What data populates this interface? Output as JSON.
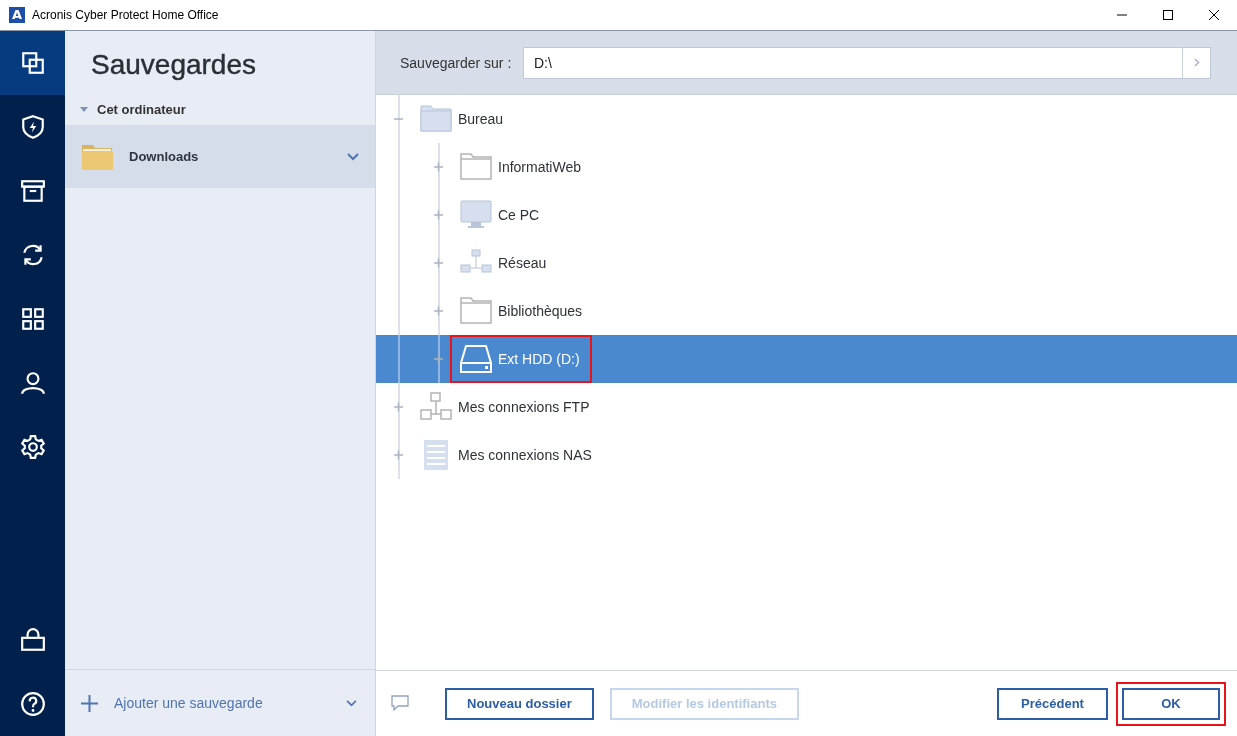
{
  "window": {
    "logo": "A",
    "title": "Acronis Cyber Protect Home Office"
  },
  "nav": {
    "top": [
      {
        "selected": true
      },
      {
        "selected": false
      },
      {
        "selected": false
      },
      {
        "selected": false
      },
      {
        "selected": false
      },
      {
        "selected": false
      },
      {
        "selected": false
      }
    ],
    "bottom": [
      {
        "selected": false
      },
      {
        "selected": false
      }
    ]
  },
  "backups_panel": {
    "title": "Sauvegardes",
    "section": {
      "label": "Cet ordinateur",
      "expanded": true
    },
    "items": [
      {
        "name": "Downloads",
        "selected": true
      }
    ],
    "add_label": "Ajouter une sauvegarde"
  },
  "destination": {
    "label": "Sauvegarder sur :",
    "path": "D:\\"
  },
  "tree": [
    {
      "label": "Bureau",
      "kind": "desktop",
      "expanded": true,
      "selected": false,
      "highlighted": false,
      "children": [
        {
          "label": "InformatiWeb",
          "kind": "folder",
          "expanded": false,
          "selected": false,
          "highlighted": false
        },
        {
          "label": "Ce PC",
          "kind": "computer",
          "expanded": false,
          "selected": false,
          "highlighted": false
        },
        {
          "label": "Réseau",
          "kind": "network",
          "expanded": false,
          "selected": false,
          "highlighted": false
        },
        {
          "label": "Bibliothèques",
          "kind": "folder",
          "expanded": false,
          "selected": false,
          "highlighted": false
        },
        {
          "label": "Ext HDD (D:)",
          "kind": "drive",
          "expanded": false,
          "selected": true,
          "highlighted": true
        }
      ]
    },
    {
      "label": "Mes connexions FTP",
      "kind": "ftp",
      "expanded": false,
      "selected": false,
      "highlighted": false
    },
    {
      "label": "Mes connexions NAS",
      "kind": "nas",
      "expanded": false,
      "selected": false,
      "highlighted": false
    }
  ],
  "footer": {
    "left_buttons": [
      {
        "label": "Nouveau dossier",
        "disabled": false,
        "highlighted": false
      },
      {
        "label": "Modifier les identifiants",
        "disabled": true,
        "highlighted": false
      }
    ],
    "right_buttons": [
      {
        "label": "Précédent",
        "disabled": false,
        "highlighted": false
      },
      {
        "label": "OK",
        "disabled": false,
        "highlighted": true
      }
    ]
  }
}
